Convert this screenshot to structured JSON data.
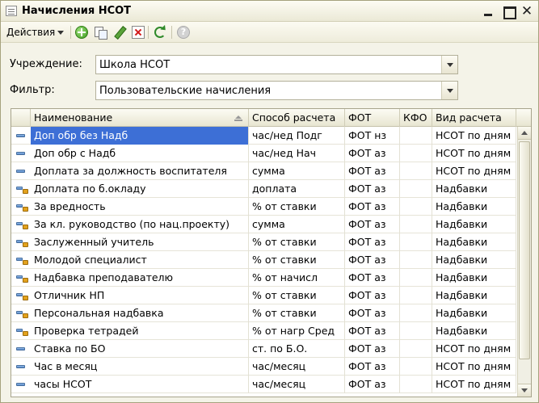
{
  "window": {
    "title": "Начисления НСОТ"
  },
  "toolbar": {
    "actions_label": "Действия",
    "icons": [
      "add-icon",
      "copy-icon",
      "edit-icon",
      "delete-icon",
      "refresh-icon",
      "help-icon"
    ],
    "help_glyph": "?"
  },
  "form": {
    "institution_label": "Учреждение:",
    "institution_value": "Школа НСОТ",
    "filter_label": "Фильтр:",
    "filter_value": "Пользовательские начисления"
  },
  "table": {
    "columns": [
      "Наименование",
      "Способ расчета",
      "ФОТ",
      "КФО",
      "Вид расчета"
    ],
    "selected_row": 0,
    "rows": [
      {
        "icon": "flat",
        "name": "Доп обр без Надб",
        "method": "час/нед Подг",
        "fot": "ФОТ нз",
        "kfo": "",
        "type": "НСОТ по дням"
      },
      {
        "icon": "flat",
        "name": "Доп обр с Надб",
        "method": "час/нед Нач",
        "fot": "ФОТ аз",
        "kfo": "",
        "type": "НСОТ по дням"
      },
      {
        "icon": "flat",
        "name": "Доплата за должность воспитателя",
        "method": "сумма",
        "fot": "ФОТ аз",
        "kfo": "",
        "type": "НСОТ по дням"
      },
      {
        "icon": "bonus",
        "name": "Доплата по б.окладу",
        "method": "доплата",
        "fot": "ФОТ аз",
        "kfo": "",
        "type": "Надбавки"
      },
      {
        "icon": "bonus",
        "name": "За вредность",
        "method": "% от ставки",
        "fot": "ФОТ аз",
        "kfo": "",
        "type": "Надбавки"
      },
      {
        "icon": "bonus",
        "name": "За кл. руководство (по нац.проекту)",
        "method": "сумма",
        "fot": "ФОТ аз",
        "kfo": "",
        "type": "Надбавки"
      },
      {
        "icon": "bonus",
        "name": "Заслуженный учитель",
        "method": "% от ставки",
        "fot": "ФОТ аз",
        "kfo": "",
        "type": "Надбавки"
      },
      {
        "icon": "bonus",
        "name": "Молодой специалист",
        "method": "% от ставки",
        "fot": "ФОТ аз",
        "kfo": "",
        "type": "Надбавки"
      },
      {
        "icon": "bonus",
        "name": "Надбавка преподавателю",
        "method": "% от начисл",
        "fot": "ФОТ аз",
        "kfo": "",
        "type": "Надбавки"
      },
      {
        "icon": "bonus",
        "name": "Отличник НП",
        "method": "% от ставки",
        "fot": "ФОТ аз",
        "kfo": "",
        "type": "Надбавки"
      },
      {
        "icon": "bonus",
        "name": "Персональная надбавка",
        "method": "% от ставки",
        "fot": "ФОТ аз",
        "kfo": "",
        "type": "Надбавки"
      },
      {
        "icon": "bonus",
        "name": "Проверка тетрадей",
        "method": "% от нагр Сред",
        "fot": "ФОТ аз",
        "kfo": "",
        "type": "Надбавки"
      },
      {
        "icon": "flat",
        "name": "Ставка по БО",
        "method": "ст. по Б.О.",
        "fot": "ФОТ аз",
        "kfo": "",
        "type": "НСОТ по дням"
      },
      {
        "icon": "flat",
        "name": "Час в месяц",
        "method": "час/месяц",
        "fot": "ФОТ аз",
        "kfo": "",
        "type": "НСОТ по дням"
      },
      {
        "icon": "flat",
        "name": "часы НСОТ",
        "method": "час/месяц",
        "fot": "ФОТ аз",
        "kfo": "",
        "type": "НСОТ по дням"
      }
    ]
  },
  "colors": {
    "selection": "#3d6fd6",
    "window_bg": "#f4f3e8",
    "grid_border": "#a7a48c"
  }
}
